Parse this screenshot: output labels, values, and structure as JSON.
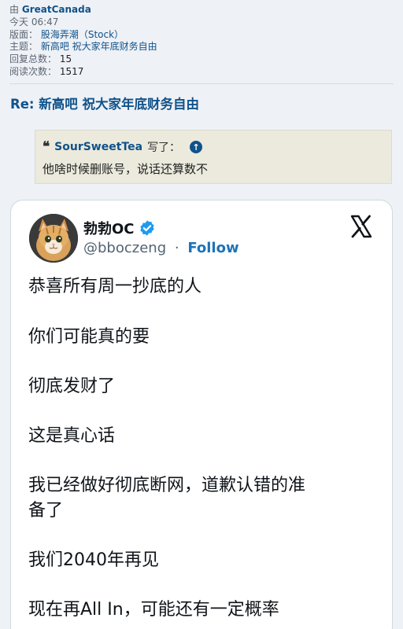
{
  "meta": {
    "by_label": "由",
    "author": "GreatCanada",
    "time_label": "今天",
    "time": "06:47",
    "board_label": "版面：",
    "board": "股海弄潮（Stock）",
    "subject_label": "主题：",
    "subject": "新高吧 祝大家年底财务自由",
    "replies_label": "回复总数：",
    "replies": "15",
    "reads_label": "阅读次数：",
    "reads": "1517"
  },
  "post": {
    "title": "Re: 新高吧 祝大家年底财务自由"
  },
  "quote": {
    "icon": "quote-icon",
    "user": "SourSweetTea",
    "wrote": "写了：",
    "jump_icon": "arrow-up-circle-icon",
    "text": "他啥时候删账号，说话还算数不"
  },
  "tweet": {
    "display_name": "勃勃OC",
    "handle": "@bboczeng",
    "separator": "·",
    "follow_label": "Follow",
    "verified_color": "#1d9bf0",
    "lines": [
      "恭喜所有周一抄底的人",
      "你们可能真的要",
      "彻底发财了",
      "这是真心话",
      "我已经做好彻底断网，道歉认错的准",
      "备了",
      "我们2040年再见",
      "现在再All In，可能还有一定概率"
    ]
  },
  "colors": {
    "link": "#105289",
    "background": "#eef1f6",
    "quote_bg": "#ebeadd",
    "follow": "#1d73b8"
  }
}
